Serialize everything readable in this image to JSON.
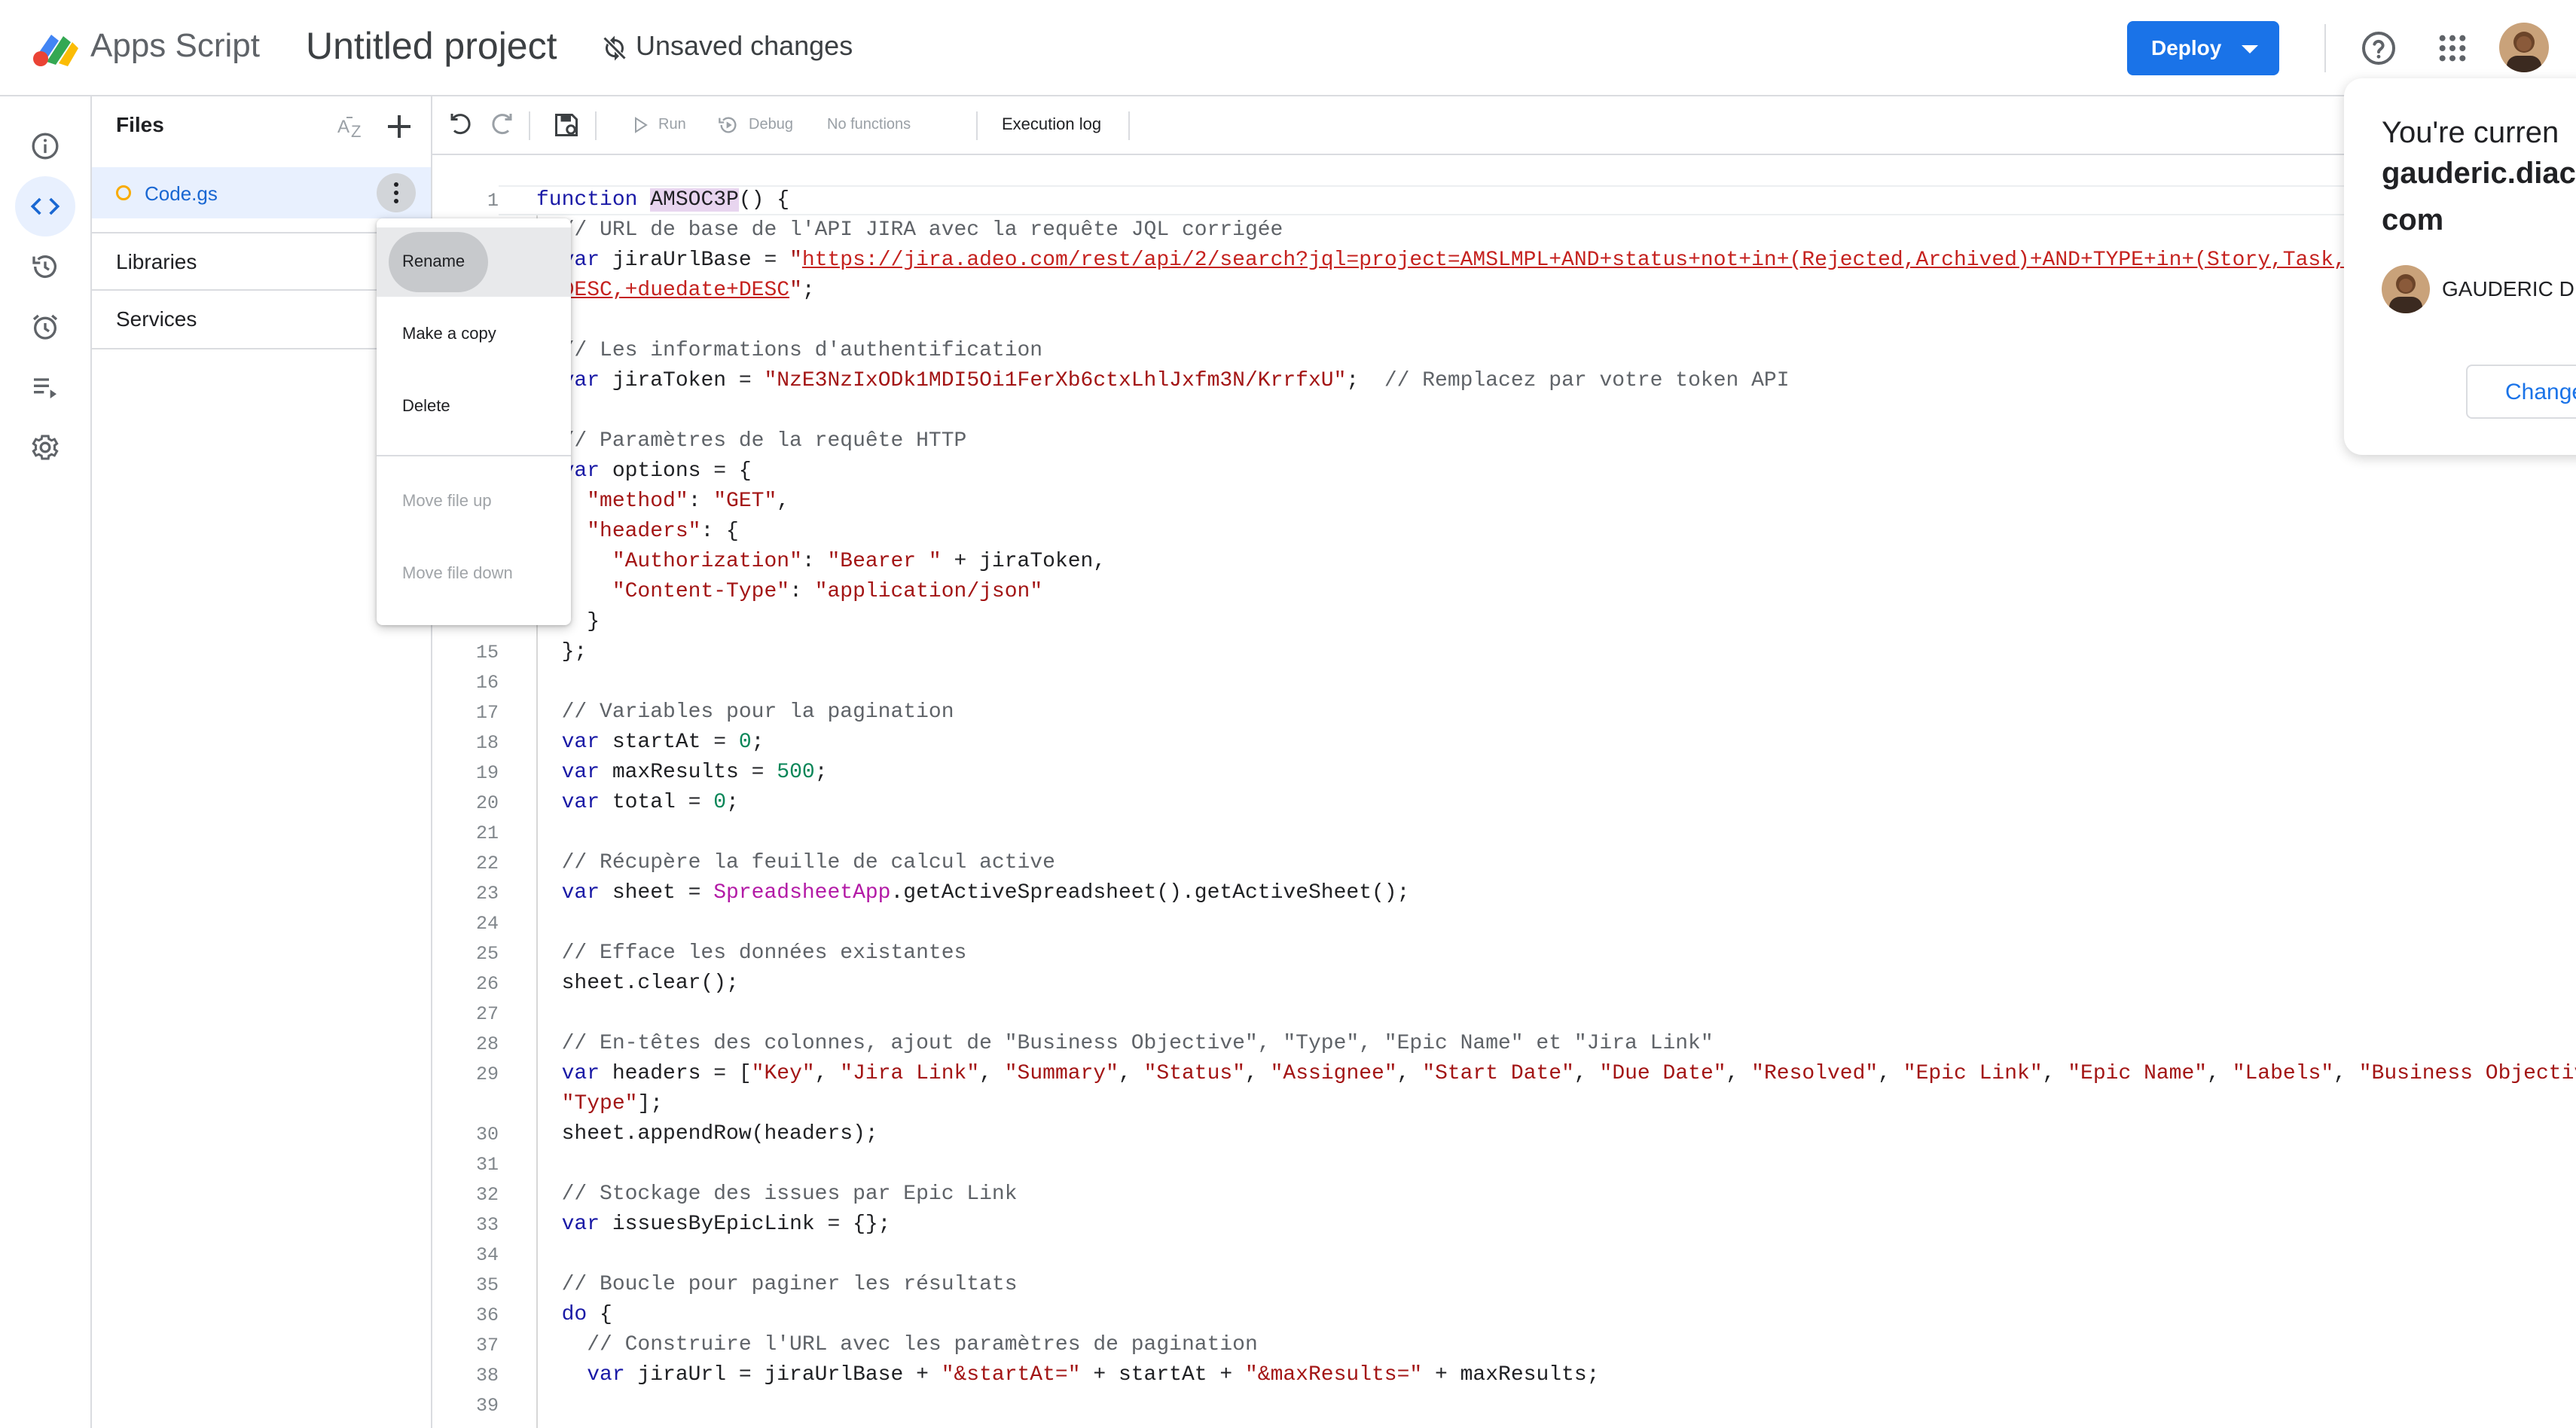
{
  "header": {
    "app_name": "Apps Script",
    "project_title": "Untitled project",
    "save_status": "Unsaved changes",
    "deploy_label": "Deploy"
  },
  "rail": {
    "items": [
      "overview-icon",
      "editor-icon",
      "executions-icon",
      "triggers-icon",
      "executions-list-icon",
      "settings-icon"
    ],
    "active": "editor-icon"
  },
  "files_panel": {
    "title": "Files",
    "files": [
      {
        "name": "Code.gs"
      }
    ],
    "sections": [
      "Libraries",
      "Services"
    ]
  },
  "toolbar": {
    "run": "Run",
    "debug": "Debug",
    "function_select": "No functions",
    "execution_log": "Execution log"
  },
  "context_menu": {
    "items": [
      {
        "label": "Rename",
        "enabled": true
      },
      {
        "label": "Make a copy",
        "enabled": true
      },
      {
        "label": "Delete",
        "enabled": true
      },
      {
        "label": "Move file up",
        "enabled": false
      },
      {
        "label": "Move file down",
        "enabled": false
      }
    ]
  },
  "account_popup": {
    "line1": "You're curren",
    "line2": "gauderic.diac",
    "line3": "com",
    "name": "GAUDERIC DI",
    "change_label": "Change"
  },
  "editor": {
    "line_numbers": [
      "1",
      "15",
      "16",
      "17",
      "18",
      "19",
      "20",
      "21",
      "22",
      "23",
      "24",
      "25",
      "26",
      "27",
      "28",
      "29",
      "30",
      "31",
      "32",
      "33",
      "34",
      "35",
      "36",
      "37",
      "38",
      "39"
    ],
    "lines": [
      [
        {
          "t": "function ",
          "c": "kw"
        },
        {
          "t": "AMSOC3P",
          "c": "hl"
        },
        {
          "t": "() {",
          "c": ""
        }
      ],
      [
        {
          "t": "  // URL de base de l'API JIRA avec la requête JQL corrigée",
          "c": "cm"
        }
      ],
      [
        {
          "t": "  var ",
          "c": "kw"
        },
        {
          "t": "jiraUrlBase = ",
          "c": ""
        },
        {
          "t": "\"",
          "c": "str"
        },
        {
          "t": "https://jira.adeo.com/rest/api/2/search?jql=project=AMSLMPL+AND+status+not+in+(Rejected,Archived)+AND+TYPE+in+(Story,Task,Sub-task)+O",
          "c": "url"
        }
      ],
      [
        {
          "t": "  ",
          "c": ""
        },
        {
          "t": "DESC,+duedate+DESC",
          "c": "url"
        },
        {
          "t": "\"",
          "c": "str"
        },
        {
          "t": ";",
          "c": ""
        }
      ],
      [
        {
          "t": "",
          "c": ""
        }
      ],
      [
        {
          "t": "  // Les informations d'authentification",
          "c": "cm"
        }
      ],
      [
        {
          "t": "  var ",
          "c": "kw"
        },
        {
          "t": "jiraToken = ",
          "c": ""
        },
        {
          "t": "\"NzE3NzIxODk1MDI5Oi1FerXb6ctxLhlJxfm3N/KrrfxU\"",
          "c": "str"
        },
        {
          "t": ";  ",
          "c": ""
        },
        {
          "t": "// Remplacez par votre token API",
          "c": "cm"
        }
      ],
      [
        {
          "t": "",
          "c": ""
        }
      ],
      [
        {
          "t": "  // Paramètres de la requête HTTP",
          "c": "cm"
        }
      ],
      [
        {
          "t": "  var ",
          "c": "kw"
        },
        {
          "t": "options = {",
          "c": ""
        }
      ],
      [
        {
          "t": "    ",
          "c": ""
        },
        {
          "t": "\"method\"",
          "c": "str"
        },
        {
          "t": ": ",
          "c": ""
        },
        {
          "t": "\"GET\"",
          "c": "str"
        },
        {
          "t": ",",
          "c": ""
        }
      ],
      [
        {
          "t": "    ",
          "c": ""
        },
        {
          "t": "\"headers\"",
          "c": "str"
        },
        {
          "t": ": {",
          "c": ""
        }
      ],
      [
        {
          "t": "      ",
          "c": ""
        },
        {
          "t": "\"Authorization\"",
          "c": "str"
        },
        {
          "t": ": ",
          "c": ""
        },
        {
          "t": "\"Bearer \"",
          "c": "str"
        },
        {
          "t": " + jiraToken,",
          "c": ""
        }
      ],
      [
        {
          "t": "      ",
          "c": ""
        },
        {
          "t": "\"Content-Type\"",
          "c": "str"
        },
        {
          "t": ": ",
          "c": ""
        },
        {
          "t": "\"application/json\"",
          "c": "str"
        }
      ],
      [
        {
          "t": "    }",
          "c": ""
        }
      ],
      [
        {
          "t": "  };",
          "c": ""
        }
      ],
      [
        {
          "t": "",
          "c": ""
        }
      ],
      [
        {
          "t": "  // Variables pour la pagination",
          "c": "cm"
        }
      ],
      [
        {
          "t": "  var ",
          "c": "kw"
        },
        {
          "t": "startAt = ",
          "c": ""
        },
        {
          "t": "0",
          "c": "num"
        },
        {
          "t": ";",
          "c": ""
        }
      ],
      [
        {
          "t": "  var ",
          "c": "kw"
        },
        {
          "t": "maxResults = ",
          "c": ""
        },
        {
          "t": "500",
          "c": "num"
        },
        {
          "t": ";",
          "c": ""
        }
      ],
      [
        {
          "t": "  var ",
          "c": "kw"
        },
        {
          "t": "total = ",
          "c": ""
        },
        {
          "t": "0",
          "c": "num"
        },
        {
          "t": ";",
          "c": ""
        }
      ],
      [
        {
          "t": "",
          "c": ""
        }
      ],
      [
        {
          "t": "  // Récupère la feuille de calcul active",
          "c": "cm"
        }
      ],
      [
        {
          "t": "  var ",
          "c": "kw"
        },
        {
          "t": "sheet = ",
          "c": ""
        },
        {
          "t": "SpreadsheetApp",
          "c": "cls"
        },
        {
          "t": ".getActiveSpreadsheet().getActiveSheet();",
          "c": ""
        }
      ],
      [
        {
          "t": "",
          "c": ""
        }
      ],
      [
        {
          "t": "  // Efface les données existantes",
          "c": "cm"
        }
      ],
      [
        {
          "t": "  sheet.clear();",
          "c": ""
        }
      ],
      [
        {
          "t": "",
          "c": ""
        }
      ],
      [
        {
          "t": "  // En-têtes des colonnes, ajout de \"Business Objective\", \"Type\", \"Epic Name\" et \"Jira Link\"",
          "c": "cm"
        }
      ],
      [
        {
          "t": "  var ",
          "c": "kw"
        },
        {
          "t": "headers = [",
          "c": ""
        },
        {
          "t": "\"Key\"",
          "c": "str"
        },
        {
          "t": ", ",
          "c": ""
        },
        {
          "t": "\"Jira Link\"",
          "c": "str"
        },
        {
          "t": ", ",
          "c": ""
        },
        {
          "t": "\"Summary\"",
          "c": "str"
        },
        {
          "t": ", ",
          "c": ""
        },
        {
          "t": "\"Status\"",
          "c": "str"
        },
        {
          "t": ", ",
          "c": ""
        },
        {
          "t": "\"Assignee\"",
          "c": "str"
        },
        {
          "t": ", ",
          "c": ""
        },
        {
          "t": "\"Start Date\"",
          "c": "str"
        },
        {
          "t": ", ",
          "c": ""
        },
        {
          "t": "\"Due Date\"",
          "c": "str"
        },
        {
          "t": ", ",
          "c": ""
        },
        {
          "t": "\"Resolved\"",
          "c": "str"
        },
        {
          "t": ", ",
          "c": ""
        },
        {
          "t": "\"Epic Link\"",
          "c": "str"
        },
        {
          "t": ", ",
          "c": ""
        },
        {
          "t": "\"Epic Name\"",
          "c": "str"
        },
        {
          "t": ", ",
          "c": ""
        },
        {
          "t": "\"Labels\"",
          "c": "str"
        },
        {
          "t": ", ",
          "c": ""
        },
        {
          "t": "\"Business Objective\"",
          "c": "str"
        },
        {
          "t": ",",
          "c": ""
        }
      ],
      [
        {
          "t": "  ",
          "c": ""
        },
        {
          "t": "\"Type\"",
          "c": "str"
        },
        {
          "t": "];",
          "c": ""
        }
      ],
      [
        {
          "t": "  sheet.appendRow(headers);",
          "c": ""
        }
      ],
      [
        {
          "t": "",
          "c": ""
        }
      ],
      [
        {
          "t": "  // Stockage des issues par Epic Link",
          "c": "cm"
        }
      ],
      [
        {
          "t": "  var ",
          "c": "kw"
        },
        {
          "t": "issuesByEpicLink = {};",
          "c": ""
        }
      ],
      [
        {
          "t": "",
          "c": ""
        }
      ],
      [
        {
          "t": "  // Boucle pour paginer les résultats",
          "c": "cm"
        }
      ],
      [
        {
          "t": "  do",
          "c": "kw"
        },
        {
          "t": " {",
          "c": ""
        }
      ],
      [
        {
          "t": "    // Construire l'URL avec les paramètres de pagination",
          "c": "cm"
        }
      ],
      [
        {
          "t": "    var ",
          "c": "kw"
        },
        {
          "t": "jiraUrl = jiraUrlBase + ",
          "c": ""
        },
        {
          "t": "\"&startAt=\"",
          "c": "str"
        },
        {
          "t": " + startAt + ",
          "c": ""
        },
        {
          "t": "\"&maxResults=\"",
          "c": "str"
        },
        {
          "t": " + maxResults;",
          "c": ""
        }
      ],
      [
        {
          "t": "",
          "c": ""
        }
      ]
    ]
  }
}
